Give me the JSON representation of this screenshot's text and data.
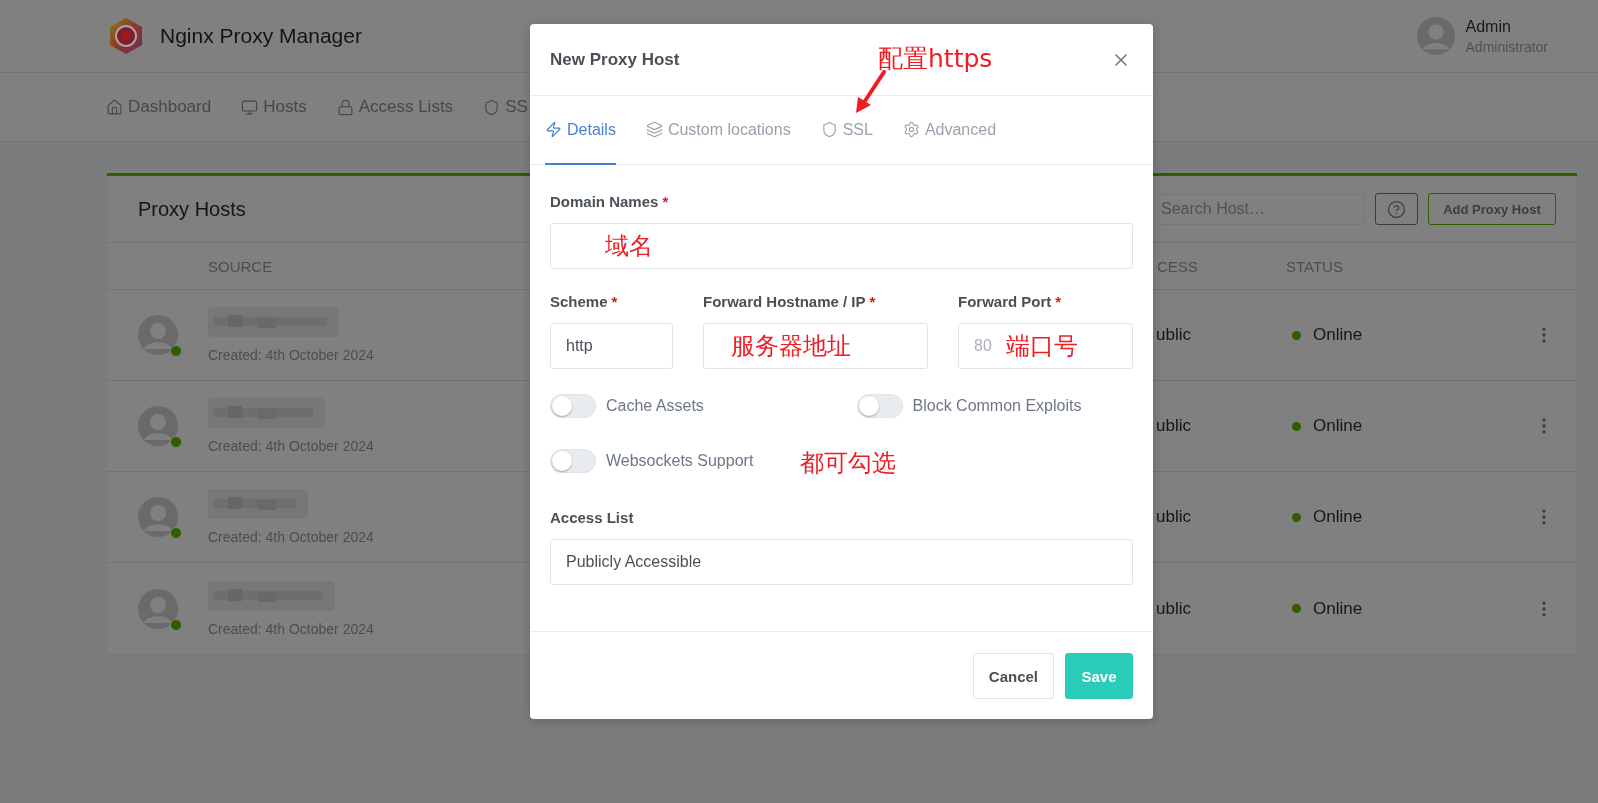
{
  "header": {
    "app_title": "Nginx Proxy Manager",
    "user": {
      "name": "Admin",
      "role": "Administrator"
    }
  },
  "nav": [
    {
      "label": "Dashboard"
    },
    {
      "label": "Hosts"
    },
    {
      "label": "Access Lists"
    },
    {
      "label": "SS"
    }
  ],
  "card": {
    "title": "Proxy Hosts",
    "search": {
      "placeholder": "Search Host…"
    },
    "add_button": "Add Proxy Host",
    "columns": [
      "SOURCE",
      "CESS",
      "STATUS"
    ],
    "rows": [
      {
        "created": "Created: 4th October 2024",
        "access": "ublic",
        "status": "Online",
        "online": true
      },
      {
        "created": "Created: 4th October 2024",
        "access": "ublic",
        "status": "Online",
        "online": true
      },
      {
        "created": "Created: 4th October 2024",
        "access": "ublic",
        "status": "Online",
        "online": true
      },
      {
        "created": "Created: 4th October 2024",
        "access": "ublic",
        "status": "Online",
        "online": true
      }
    ]
  },
  "modal": {
    "title": "New Proxy Host",
    "tabs": [
      {
        "label": "Details",
        "selected": true
      },
      {
        "label": "Custom locations",
        "selected": false
      },
      {
        "label": "SSL",
        "selected": false
      },
      {
        "label": "Advanced",
        "selected": false
      }
    ],
    "tabs_annotation": "配置https",
    "domain": {
      "label": "Domain Names",
      "required_mark": "*",
      "annotation": "域名"
    },
    "forward": [
      {
        "label": "Scheme",
        "required_mark": "*",
        "value": "http"
      },
      {
        "label": "Forward Hostname / IP",
        "required_mark": "*",
        "annotation": "服务器地址"
      },
      {
        "label": "Forward Port",
        "required_mark": "*",
        "placeholder": "80",
        "annotation": "端口号"
      }
    ],
    "toggles": [
      {
        "label": "Cache Assets",
        "on": false
      },
      {
        "label": "Block Common Exploits",
        "on": false
      },
      {
        "label": "Websockets Support",
        "on": false
      }
    ],
    "toggles_annotation": "都可勾选",
    "access": {
      "label": "Access List",
      "value": "Publicly Accessible"
    },
    "buttons": [
      {
        "label": "Cancel",
        "kind": "secondary"
      },
      {
        "label": "Save",
        "kind": "primary"
      }
    ]
  }
}
